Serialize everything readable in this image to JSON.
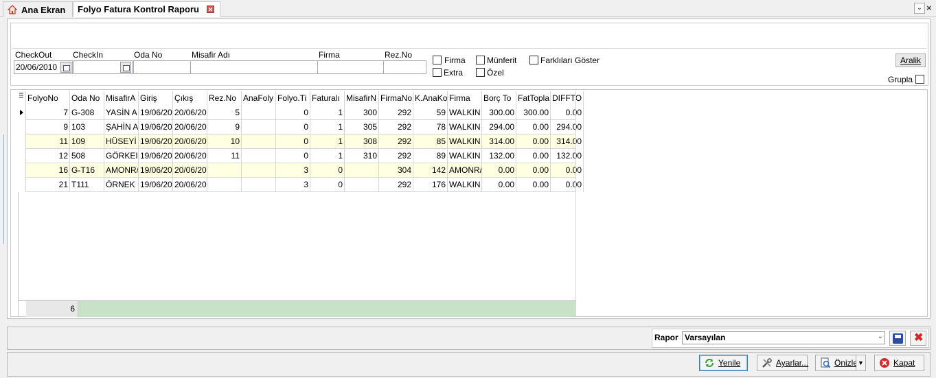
{
  "tabs": [
    {
      "label": "Ana Ekran"
    },
    {
      "label": "Folyo Fatura Kontrol Raporu"
    }
  ],
  "filters": {
    "checkout_label": "CheckOut",
    "checkout_value": "20/06/2010",
    "checkin_label": "CheckIn",
    "checkin_value": "",
    "oda_label": "Oda No",
    "misafir_label": "Misafir Adı",
    "firma_label": "Firma",
    "rez_label": "Rez.No",
    "chk_firma": "Firma",
    "chk_munferit": "Münferit",
    "chk_farkli": "Farklıları Göster",
    "chk_extra": "Extra",
    "chk_ozel": "Özel",
    "aralik_label": "Aralik",
    "grupla_label": "Grupla"
  },
  "grid": {
    "columns": [
      "FolyoNo",
      "Oda No",
      "MisafirA",
      "Giriş",
      "Çıkış",
      "Rez.No",
      "AnaFoly",
      "Folyo.Ti",
      "Faturalı",
      "MisafirN",
      "FirmaNo",
      "K.AnaKo",
      "Firma",
      "Borç To",
      "FatTopla",
      "DIFFTO"
    ],
    "rows": [
      [
        "7",
        "G-308",
        "YASİN A",
        "19/06/20",
        "20/06/20",
        "5",
        "",
        "0",
        "1",
        "300",
        "292",
        "59",
        "WALKIN",
        "300.00",
        "300.00",
        "0.00"
      ],
      [
        "9",
        "103",
        "ŞAHİN A",
        "19/06/20",
        "20/06/20",
        "9",
        "",
        "0",
        "1",
        "305",
        "292",
        "78",
        "WALKIN",
        "294.00",
        "0.00",
        "294.00"
      ],
      [
        "11",
        "109",
        "HÜSEYİ",
        "19/06/20",
        "20/06/20",
        "10",
        "",
        "0",
        "1",
        "308",
        "292",
        "85",
        "WALKIN",
        "314.00",
        "0.00",
        "314.00"
      ],
      [
        "12",
        "508",
        "GÖRKEI",
        "19/06/20",
        "20/06/20",
        "11",
        "",
        "0",
        "1",
        "310",
        "292",
        "89",
        "WALKIN",
        "132.00",
        "0.00",
        "132.00"
      ],
      [
        "16",
        "G-T16",
        "AMONR/",
        "19/06/20",
        "20/06/20",
        "",
        "",
        "3",
        "0",
        "",
        "304",
        "142",
        "AMONR/",
        "0.00",
        "0.00",
        "0.00"
      ],
      [
        "21",
        "T111",
        "ÖRNEK",
        "19/06/20",
        "20/06/20",
        "",
        "",
        "3",
        "0",
        "",
        "292",
        "176",
        "WALKIN",
        "0.00",
        "0.00",
        "0.00"
      ]
    ],
    "record_count": "6"
  },
  "rapor": {
    "label": "Rapor",
    "selected": "Varsayılan"
  },
  "actions": {
    "yenile": "Yenile",
    "ayarlar": "Ayarlar...",
    "onizle": "Önizle",
    "kapat": "Kapat"
  },
  "colors": {
    "alt_row": "#ffffe1",
    "footer_green": "#c7e2c7",
    "tab_close": "#d9534f"
  }
}
